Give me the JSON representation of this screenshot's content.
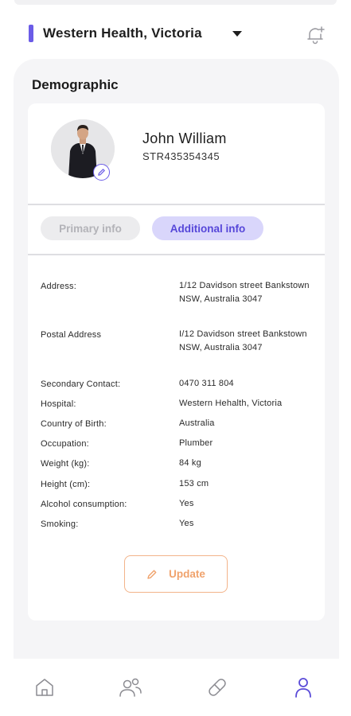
{
  "header": {
    "location": "Western  Health, Victoria",
    "accent_color": "#6b5ce7",
    "notification_icon": "bell-plus-icon"
  },
  "section_title": "Demographic",
  "profile": {
    "name": "John William",
    "id": "STR435354345",
    "avatar_icon": "person-photo",
    "edit_icon": "pencil-icon"
  },
  "tabs": [
    {
      "label": "Primary info",
      "active": false
    },
    {
      "label": "Additional info",
      "active": true
    }
  ],
  "info": {
    "address": {
      "label": "Address:",
      "value": "1/12 Davidson street Bankstown NSW, Australia 3047"
    },
    "postal": {
      "label": "Postal Address",
      "value": "I/12 Davidson street Bankstown NSW, Australia 3047"
    },
    "secondary_contact": {
      "label": "Secondary Contact:",
      "value": "0470 311 804"
    },
    "hospital": {
      "label": "Hospital:",
      "value": "Western Hehalth, Victoria"
    },
    "country_of_birth": {
      "label": "Country of Birth:",
      "value": "Australia"
    },
    "occupation": {
      "label": "Occupation:",
      "value": "Plumber"
    },
    "weight": {
      "label": "Weight (kg):",
      "value": "84 kg"
    },
    "height": {
      "label": "Height (cm):",
      "value": "153 cm"
    },
    "alcohol": {
      "label": "Alcohol consumption:",
      "value": "Yes"
    },
    "smoking": {
      "label": "Smoking:",
      "value": "Yes"
    }
  },
  "update_button": {
    "label": "Update",
    "icon": "pencil-icon",
    "color": "#f0a26c"
  },
  "bottom_nav": [
    {
      "icon": "home-icon",
      "active": false
    },
    {
      "icon": "users-icon",
      "active": false
    },
    {
      "icon": "pill-icon",
      "active": false
    },
    {
      "icon": "profile-icon",
      "active": true
    }
  ]
}
